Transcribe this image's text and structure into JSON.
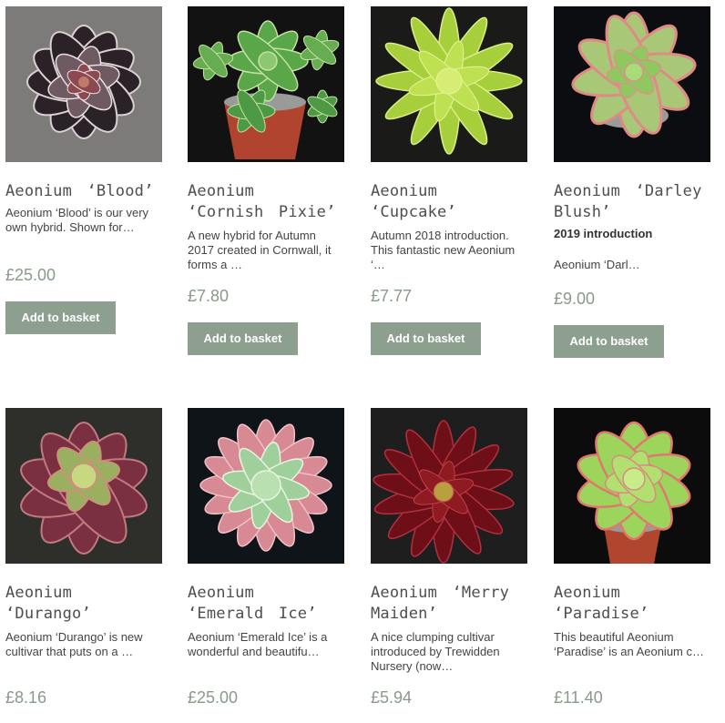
{
  "products": [
    {
      "name": "Aeonium ‘Blood’",
      "desc": "Aeonium ‘Blood’ is our very own hybrid. Shown for…",
      "price": "£25.00",
      "button": "Add to basket"
    },
    {
      "name": "Aeonium ‘Cornish Pixie’",
      "desc": "A new hybrid for Autumn 2017 created in Cornwall, it forms a …",
      "price": "£7.80",
      "button": "Add to basket"
    },
    {
      "name": "Aeonium ‘Cupcake’",
      "desc": "Autumn 2018 introduction. This fantastic new Aeonium ‘…",
      "price": "£7.77",
      "button": "Add to basket"
    },
    {
      "name": "Aeonium ‘Darley Blush’",
      "desc": "2019 introduction",
      "desc2": "Aeonium ‘Darl…",
      "price": "£9.00",
      "button": "Add to basket"
    },
    {
      "name": "Aeonium ‘Durango’",
      "desc": "Aeonium ‘Durango’ is new cultivar that puts on a …",
      "price": "£8.16"
    },
    {
      "name": "Aeonium ‘Emerald Ice’",
      "desc": "Aeonium ‘Emerald Ice’ is a wonderful and beautifu…",
      "price": "£25.00"
    },
    {
      "name": "Aeonium ‘Merry Maiden’",
      "desc": "A nice clumping cultivar introduced by Trewidden Nursery (now…",
      "price": "£5.94"
    },
    {
      "name": "Aeonium ‘Paradise’",
      "desc": "This beautiful Aeonium ‘Paradise’ is an Aeonium c…",
      "price": "£11.40"
    }
  ],
  "colors": {
    "button_bg": "#8da08f",
    "price": "#8a9a8a"
  }
}
